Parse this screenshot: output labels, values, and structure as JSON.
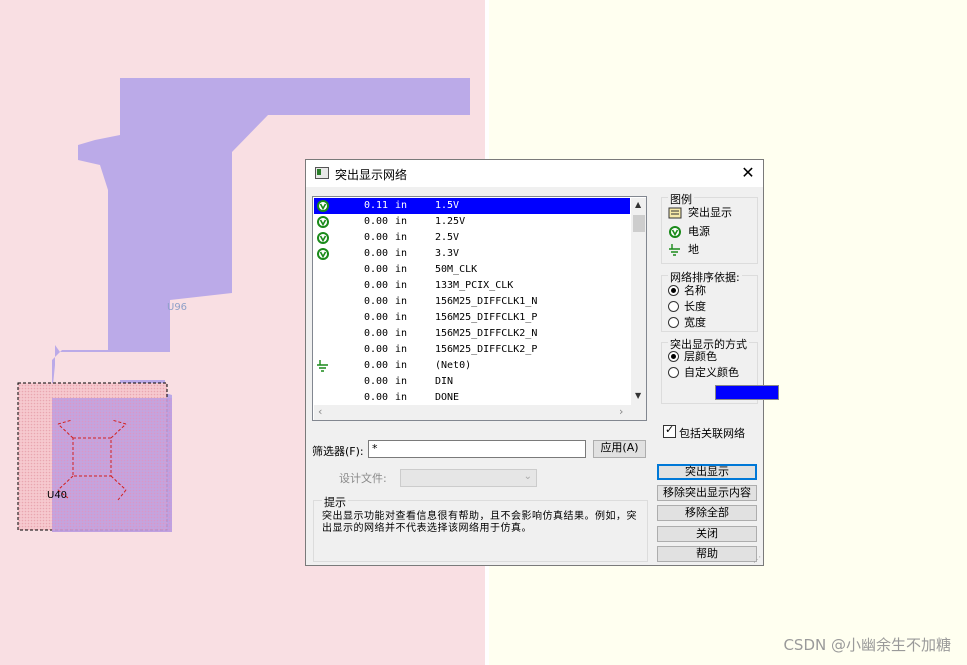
{
  "canvas": {
    "refs": [
      "U96",
      "U40"
    ]
  },
  "watermark": "CSDN @小幽余生不加糖",
  "dialog": {
    "title": "突出显示网络",
    "close_icon": "close-icon",
    "nets": [
      {
        "icon": "power-icon",
        "value": "0.11",
        "unit": "in",
        "name": "1.5V",
        "selected": true
      },
      {
        "icon": "power-icon",
        "value": "0.00",
        "unit": "in",
        "name": "1.25V"
      },
      {
        "icon": "power-icon",
        "value": "0.00",
        "unit": "in",
        "name": "2.5V"
      },
      {
        "icon": "power-icon",
        "value": "0.00",
        "unit": "in",
        "name": "3.3V"
      },
      {
        "icon": "",
        "value": "0.00",
        "unit": "in",
        "name": "50M_CLK"
      },
      {
        "icon": "",
        "value": "0.00",
        "unit": "in",
        "name": "133M_PCIX_CLK"
      },
      {
        "icon": "",
        "value": "0.00",
        "unit": "in",
        "name": "156M25_DIFFCLK1_N"
      },
      {
        "icon": "",
        "value": "0.00",
        "unit": "in",
        "name": "156M25_DIFFCLK1_P"
      },
      {
        "icon": "",
        "value": "0.00",
        "unit": "in",
        "name": "156M25_DIFFCLK2_N"
      },
      {
        "icon": "",
        "value": "0.00",
        "unit": "in",
        "name": "156M25_DIFFCLK2_P"
      },
      {
        "icon": "ground-icon",
        "value": "0.00",
        "unit": "in",
        "name": "(Net0)"
      },
      {
        "icon": "",
        "value": "0.00",
        "unit": "in",
        "name": "DIN"
      },
      {
        "icon": "",
        "value": "0.00",
        "unit": "in",
        "name": "DONE"
      }
    ],
    "filter": {
      "label": "筛选器(F):",
      "value": "*",
      "apply_label": "应用(A)"
    },
    "design_file": {
      "label": "设计文件:",
      "value": ""
    },
    "hint": {
      "legend": "提示",
      "text": "突出显示功能对查看信息很有帮助，且不会影响仿真结果。例如，突出显示的网络并不代表选择该网络用于仿真。"
    },
    "legend_group": {
      "title": "图例",
      "items": [
        {
          "icon": "highlight-icon",
          "label": "突出显示"
        },
        {
          "icon": "power-icon",
          "label": "电源"
        },
        {
          "icon": "ground-icon",
          "label": "地"
        }
      ]
    },
    "sort_group": {
      "title": "网络排序依据:",
      "options": [
        {
          "label": "名称",
          "checked": true
        },
        {
          "label": "长度",
          "checked": false
        },
        {
          "label": "宽度",
          "checked": false
        }
      ]
    },
    "mode_group": {
      "title": "突出显示的方式",
      "options": [
        {
          "label": "层颜色",
          "checked": true
        },
        {
          "label": "自定义颜色",
          "checked": false
        }
      ],
      "custom_color": "#0000ff"
    },
    "include_related": {
      "label": "包括关联网络",
      "checked": true
    },
    "buttons": {
      "highlight": "突出显示",
      "remove": "移除突出显示内容",
      "remove_all": "移除全部",
      "close": "关闭",
      "help": "帮助"
    }
  }
}
